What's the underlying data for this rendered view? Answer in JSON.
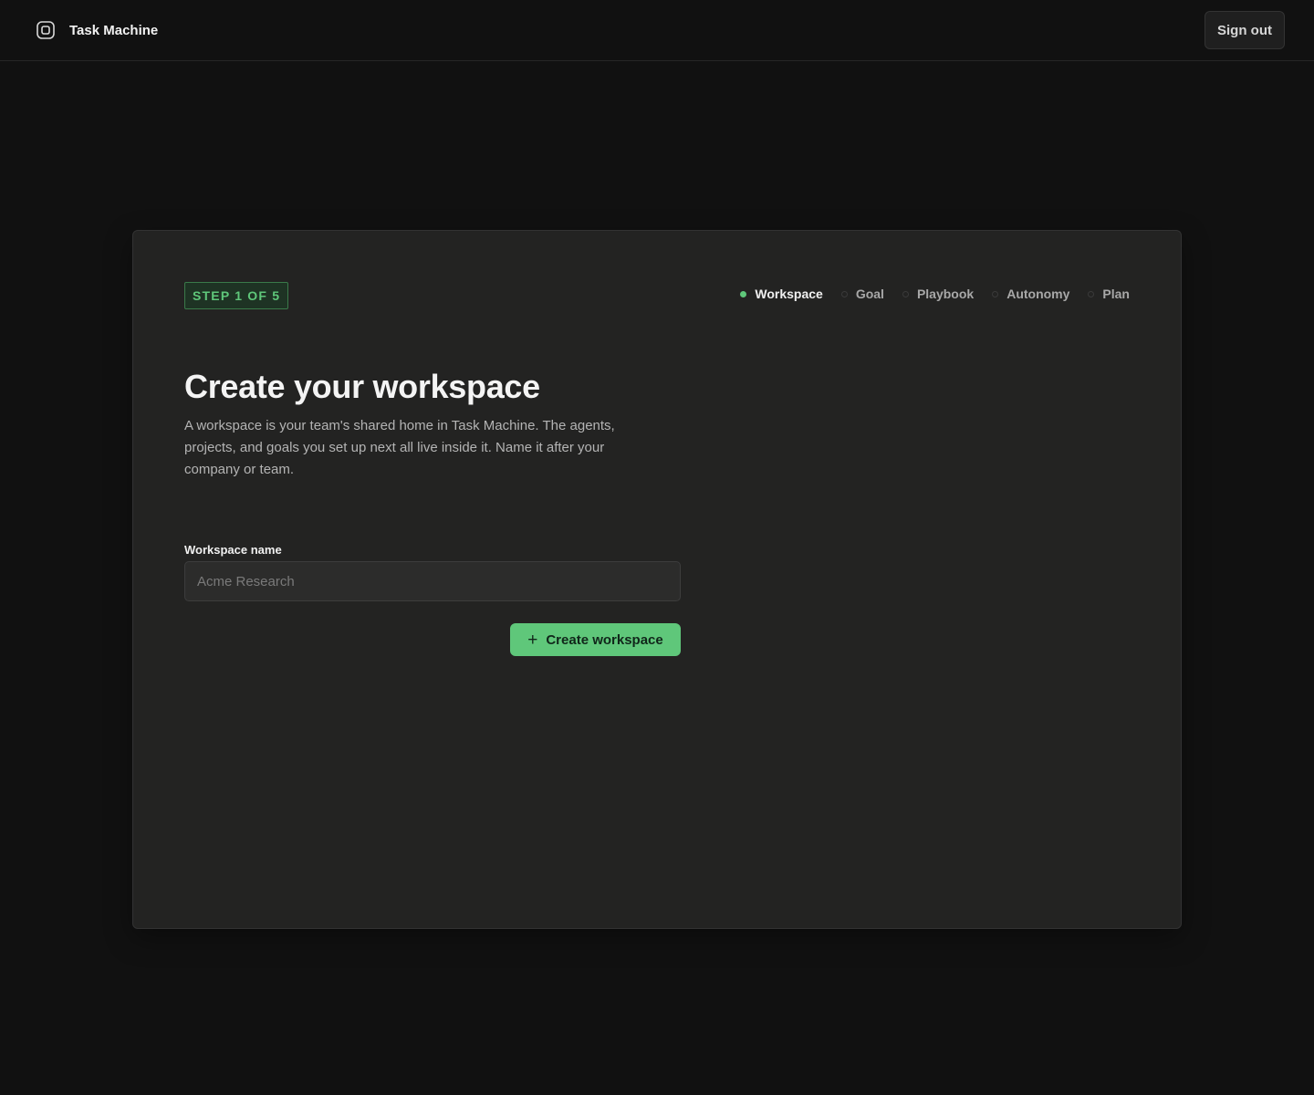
{
  "app": {
    "name": "Task Machine",
    "logo_icon": "square-chip-icon"
  },
  "header": {
    "sign_out_label": "Sign out"
  },
  "onboarding": {
    "step_badge": "STEP 1 OF 5",
    "steps": [
      {
        "label": "Workspace",
        "active": true
      },
      {
        "label": "Goal",
        "active": false
      },
      {
        "label": "Playbook",
        "active": false
      },
      {
        "label": "Autonomy",
        "active": false
      },
      {
        "label": "Plan",
        "active": false
      }
    ],
    "title": "Create your workspace",
    "description": "A workspace is your team's shared home in Task Machine. The agents, projects, and goals you set up next all live inside it. Name it after your company or team.",
    "form": {
      "label": "Workspace name",
      "value": "",
      "placeholder": "Acme Research"
    },
    "submit": {
      "icon": "plus-icon",
      "label": "Create workspace"
    }
  },
  "colors": {
    "accent": "#5fc77a",
    "background": "#111111",
    "card": "#232322"
  }
}
